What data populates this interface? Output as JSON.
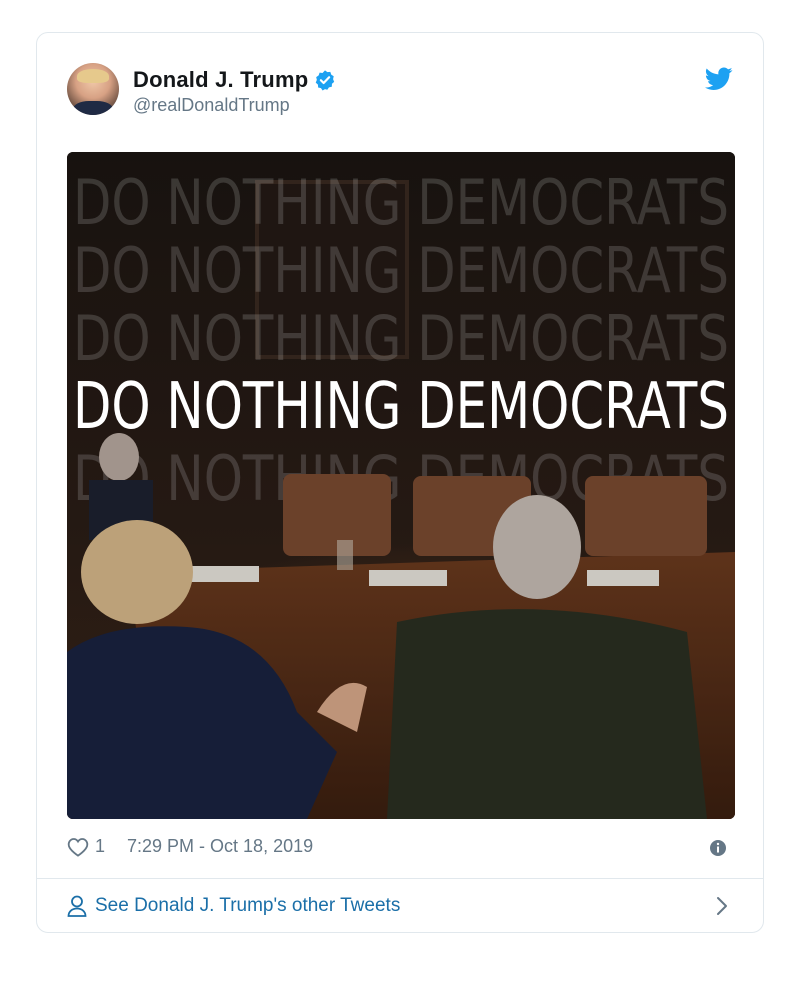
{
  "tweet": {
    "author_name": "Donald J. Trump",
    "handle": "@realDonaldTrump",
    "image_text": "DO NOTHING DEMOCRATS",
    "likes": "1",
    "timestamp": "7:29 PM - Oct 18, 2019"
  },
  "footer": {
    "label": "See Donald J. Trump's other Tweets"
  },
  "icons": {
    "verified": "verified-badge-icon",
    "twitter": "twitter-bird-icon",
    "like": "heart-icon",
    "info": "info-icon",
    "profile": "person-icon",
    "chevron": "chevron-right-icon"
  },
  "colors": {
    "brand": "#1da1f2",
    "link": "#1b6fa8",
    "muted": "#657786",
    "border": "#e1e8ed"
  }
}
